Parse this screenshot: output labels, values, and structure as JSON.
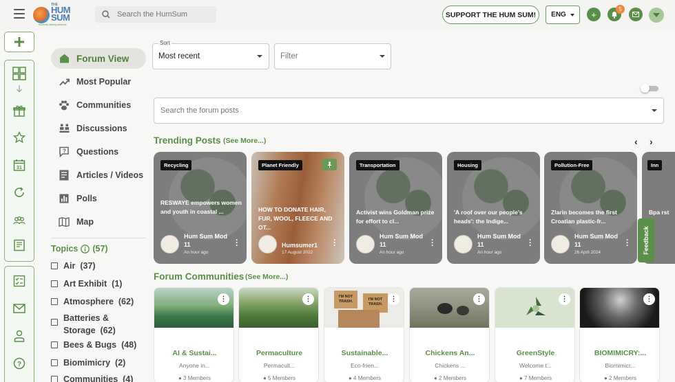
{
  "header": {
    "logo": {
      "the": "THE",
      "hum": "HUM",
      "sum": "SUM",
      "tagline": "humanity adding solutions"
    },
    "search_placeholder": "Search the HumSum",
    "support_label": "SUPPORT THE HUM SUM!",
    "language": "ENG",
    "notifications_count": "5"
  },
  "nav": {
    "items": [
      {
        "label": "Forum View",
        "icon": "home-icon"
      },
      {
        "label": "Most Popular",
        "icon": "trending-icon"
      },
      {
        "label": "Communities",
        "icon": "paw-icon"
      },
      {
        "label": "Discussions",
        "icon": "people-icon"
      },
      {
        "label": "Questions",
        "icon": "question-bubble-icon"
      },
      {
        "label": "Articles / Videos",
        "icon": "article-icon"
      },
      {
        "label": "Polls",
        "icon": "poll-icon"
      },
      {
        "label": "Map",
        "icon": "map-icon"
      }
    ],
    "topics_label": "Topics",
    "topics_count": "(57)",
    "topics": [
      {
        "label": "Air",
        "count": "(37)"
      },
      {
        "label": "Art Exhibit",
        "count": "(1)"
      },
      {
        "label": "Atmosphere",
        "count": "(62)"
      },
      {
        "label": "Batteries &",
        "label2": "Storage",
        "count": "(62)"
      },
      {
        "label": "Bees & Bugs",
        "count": "(48)"
      },
      {
        "label": "Biomimicry",
        "count": "(2)"
      },
      {
        "label": "Communities",
        "count": "(4)"
      }
    ]
  },
  "controls": {
    "sort_label": "Sort",
    "sort_value": "Most recent",
    "filter_placeholder": "Filter",
    "post_search_placeholder": "Search the forum posts"
  },
  "trending": {
    "title": "Trending Posts",
    "see_more": "(See More...)",
    "cards": [
      {
        "tag": "Recycling",
        "title": "RESWAYE empowers women and youth in coastal ...",
        "author": "Hum Sum Mod 11",
        "time": "An hour ago"
      },
      {
        "tag": "Planet Friendly",
        "title": "HOW TO DONATE HAIR, FUR, WOOL, FLEECE AND OT...",
        "author": "Humsumer1",
        "time": "17 August 2022"
      },
      {
        "tag": "Transportation",
        "title": "Activist wins Goldman prize for effort to cl...",
        "author": "Hum Sum Mod 11",
        "time": "An hour ago"
      },
      {
        "tag": "Housing",
        "title": "'A roof over our people's heads': the Indige...",
        "author": "Hum Sum Mod 11",
        "time": "An hour ago"
      },
      {
        "tag": "Pollution-Free",
        "title": "Zlarin becomes the first Croatian plastic-fr...",
        "author": "Hum Sum Mod 11",
        "time": "26 April 2024"
      },
      {
        "tag": "Inn",
        "title": "Bpa rst",
        "author": "",
        "time": ""
      }
    ]
  },
  "communities": {
    "title": "Forum Communities",
    "see_more": "(See More...)",
    "cards": [
      {
        "name": "AI & Sustai...",
        "desc": "Anyone in...",
        "members": "3 Members"
      },
      {
        "name": "Permaculture",
        "desc": "Permacult...",
        "members": "5 Members"
      },
      {
        "name": "Sustainable...",
        "desc": "Eco-frien...",
        "members": "4 Members"
      },
      {
        "name": "Chickens An...",
        "desc": "Chickens ...",
        "members": "2 Members"
      },
      {
        "name": "GreenStyle",
        "desc": "Welcome t...",
        "members": "7 Members"
      },
      {
        "name": "BIOMIMICRY:...",
        "desc": "Biomimicr...",
        "members": "2 Members"
      }
    ],
    "box_text": [
      "I'M NOT",
      "TRASH.",
      "I'M NOT",
      "TRASH."
    ]
  },
  "feedback_label": "Feedback",
  "colors": {
    "accent": "#5a8f4a",
    "card_grey": "#7d7d7d",
    "badge": "#f08a3a"
  }
}
